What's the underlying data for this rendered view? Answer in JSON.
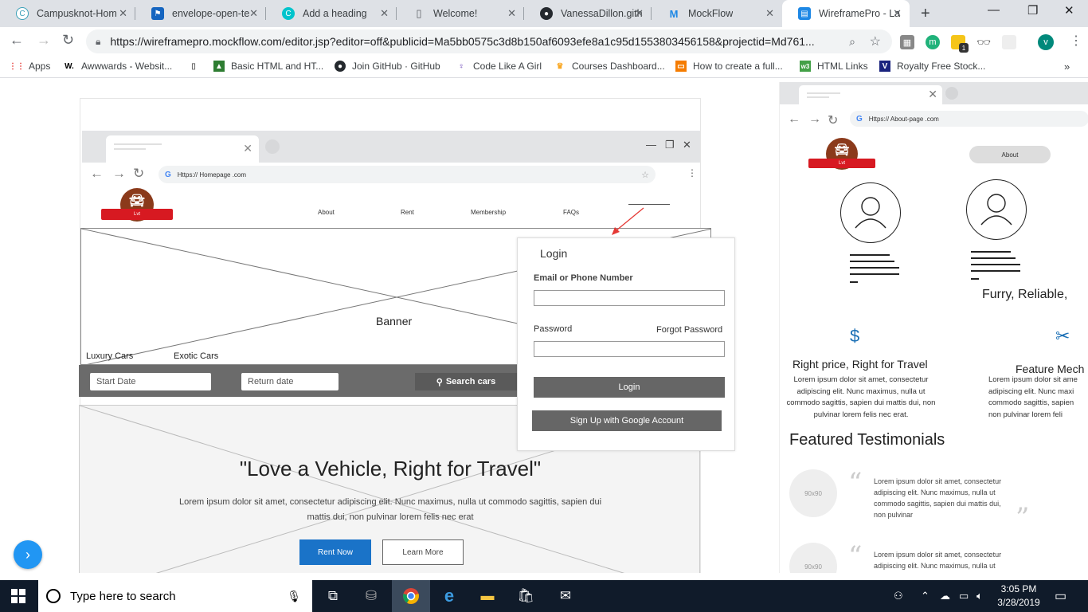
{
  "tabs": [
    {
      "title": "Campusknot-Hom",
      "icon": "campusknot-icon"
    },
    {
      "title": "envelope-open-te",
      "icon": "flag-icon"
    },
    {
      "title": "Add a heading",
      "icon": "canva-icon"
    },
    {
      "title": "Welcome!",
      "icon": "document-icon"
    },
    {
      "title": "VanessaDillon.gith",
      "icon": "github-icon"
    },
    {
      "title": "MockFlow",
      "icon": "mockflow-icon"
    },
    {
      "title": "WireframePro - La",
      "icon": "wireframepro-icon"
    }
  ],
  "address_bar": {
    "url": "https://wireframepro.mockflow.com/editor.jsp?editor=off&publicid=Ma5bb0575c3d8b150af6093efe8a1c95d1553803456158&projectid=Md761..."
  },
  "profile_initial": "v",
  "extension_badge": "1",
  "bookmarks": [
    {
      "label": "Apps"
    },
    {
      "label": "Awwwards - Websit..."
    },
    {
      "label": ""
    },
    {
      "label": "Basic HTML and HT..."
    },
    {
      "label": "Join GitHub · GitHub"
    },
    {
      "label": "Code Like A Girl"
    },
    {
      "label": "Courses Dashboard..."
    },
    {
      "label": "How to create a full..."
    },
    {
      "label": "HTML Links"
    },
    {
      "label": "Royalty Free Stock..."
    }
  ],
  "wireframe_main": {
    "url": "Https:// Homepage .com",
    "logo_text": "Lvt",
    "menu": [
      "About",
      "Rent",
      "Membership",
      "FAQs"
    ],
    "banner_label": "Banner",
    "categories": [
      "Luxury Cars",
      "Exotic Cars"
    ],
    "search": {
      "start_placeholder": "Start Date",
      "return_placeholder": "Return date",
      "button": "Search cars"
    },
    "hero_title": "\"Love a Vehicle, Right for Travel\"",
    "hero_text": "Lorem ipsum dolor sit amet, consectetur adipiscing elit. Nunc maximus, nulla ut commodo sagittis, sapien dui mattis dui, non pulvinar lorem felis nec erat",
    "rent_now": "Rent Now",
    "learn_more": "Learn More"
  },
  "login_popup": {
    "title": "Login",
    "email_label": "Email or Phone Number",
    "password_label": "Password",
    "forgot": "Forgot Password",
    "login_button": "Login",
    "google_button": "Sign Up with Google Account"
  },
  "wireframe_about": {
    "url": "Https:// About-page .com",
    "nav_pill": "About",
    "tagline": "Furry, Reliable,",
    "feature1_title": "Right price, Right for Travel",
    "feature1_text": "Lorem ipsum dolor sit amet, consectetur adipiscing elit. Nunc maximus, nulla ut commodo sagittis, sapien dui mattis dui, non pulvinar lorem felis nec erat.",
    "feature2_title": "Feature Mech",
    "feature2_text": "Lorem ipsum dolor sit ame adipiscing elit. Nunc maxi commodo sagittis, sapien non pulvinar lorem feli",
    "testimonials_title": "Featured Testimonials",
    "testimonial_img": "90x90",
    "testimonial1": "Lorem ipsum dolor sit amet, consectetur adipiscing elit. Nunc maximus, nulla ut commodo sagittis, sapien dui mattis dui, non pulvinar",
    "testimonial2": "Lorem ipsum dolor sit amet, consectetur adipiscing elit. Nunc maximus, nulla ut"
  },
  "taskbar": {
    "search_placeholder": "Type here to search",
    "time": "3:05 PM",
    "date": "3/28/2019"
  },
  "colors": {
    "accent_blue": "#1a73c8",
    "logo_brown": "#8b3a1b",
    "logo_red": "#d71921",
    "arrow_red": "#e53935"
  }
}
